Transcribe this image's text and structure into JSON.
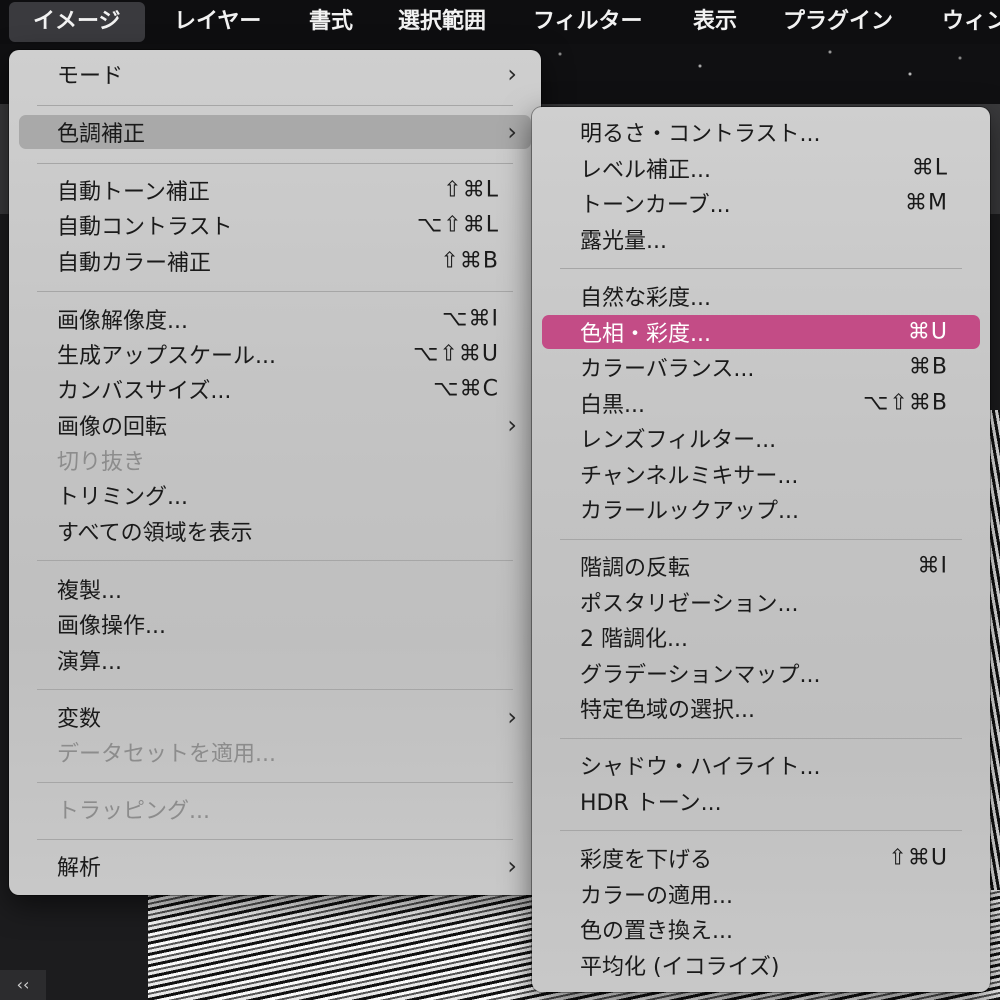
{
  "menubar": {
    "items": [
      "イメージ",
      "レイヤー",
      "書式",
      "選択範囲",
      "フィルター",
      "表示",
      "プラグイン",
      "ウィン"
    ]
  },
  "image_menu": {
    "mode": "モード",
    "adjustments": "色調補正",
    "auto_tone": "自動トーン補正",
    "auto_tone_shortcut": "⇧⌘L",
    "auto_contrast": "自動コントラスト",
    "auto_contrast_shortcut": "⌥⇧⌘L",
    "auto_color": "自動カラー補正",
    "auto_color_shortcut": "⇧⌘B",
    "image_size": "画像解像度...",
    "image_size_shortcut": "⌥⌘I",
    "generative_upscale": "生成アップスケール...",
    "generative_upscale_shortcut": "⌥⇧⌘U",
    "canvas_size": "カンバスサイズ...",
    "canvas_size_shortcut": "⌥⌘C",
    "image_rotation": "画像の回転",
    "crop": "切り抜き",
    "trim": "トリミング...",
    "reveal_all": "すべての領域を表示",
    "duplicate": "複製...",
    "apply_image": "画像操作...",
    "calculations": "演算...",
    "variables": "変数",
    "apply_data_set": "データセットを適用...",
    "trap": "トラッピング...",
    "analysis": "解析"
  },
  "adjustments_menu": {
    "brightness_contrast": "明るさ・コントラスト...",
    "levels": "レベル補正...",
    "levels_shortcut": "⌘L",
    "curves": "トーンカーブ...",
    "curves_shortcut": "⌘M",
    "exposure": "露光量...",
    "vibrance": "自然な彩度...",
    "hue_saturation": "色相・彩度...",
    "hue_saturation_shortcut": "⌘U",
    "color_balance": "カラーバランス...",
    "color_balance_shortcut": "⌘B",
    "black_white": "白黒...",
    "black_white_shortcut": "⌥⇧⌘B",
    "photo_filter": "レンズフィルター...",
    "channel_mixer": "チャンネルミキサー...",
    "color_lookup": "カラールックアップ...",
    "invert": "階調の反転",
    "invert_shortcut": "⌘I",
    "posterize": "ポスタリゼーション...",
    "threshold": "2 階調化...",
    "gradient_map": "グラデーションマップ...",
    "selective_color": "特定色域の選択...",
    "shadows_highlights": "シャドウ・ハイライト...",
    "hdr_toning": "HDR トーン...",
    "desaturate": "彩度を下げる",
    "desaturate_shortcut": "⇧⌘U",
    "match_color": "カラーの適用...",
    "replace_color": "色の置き換え...",
    "equalize": "平均化 (イコライズ)"
  },
  "icons": {
    "submenu_arrow": "›",
    "collapse": "‹‹"
  },
  "colors": {
    "selection": "#c34c86"
  }
}
